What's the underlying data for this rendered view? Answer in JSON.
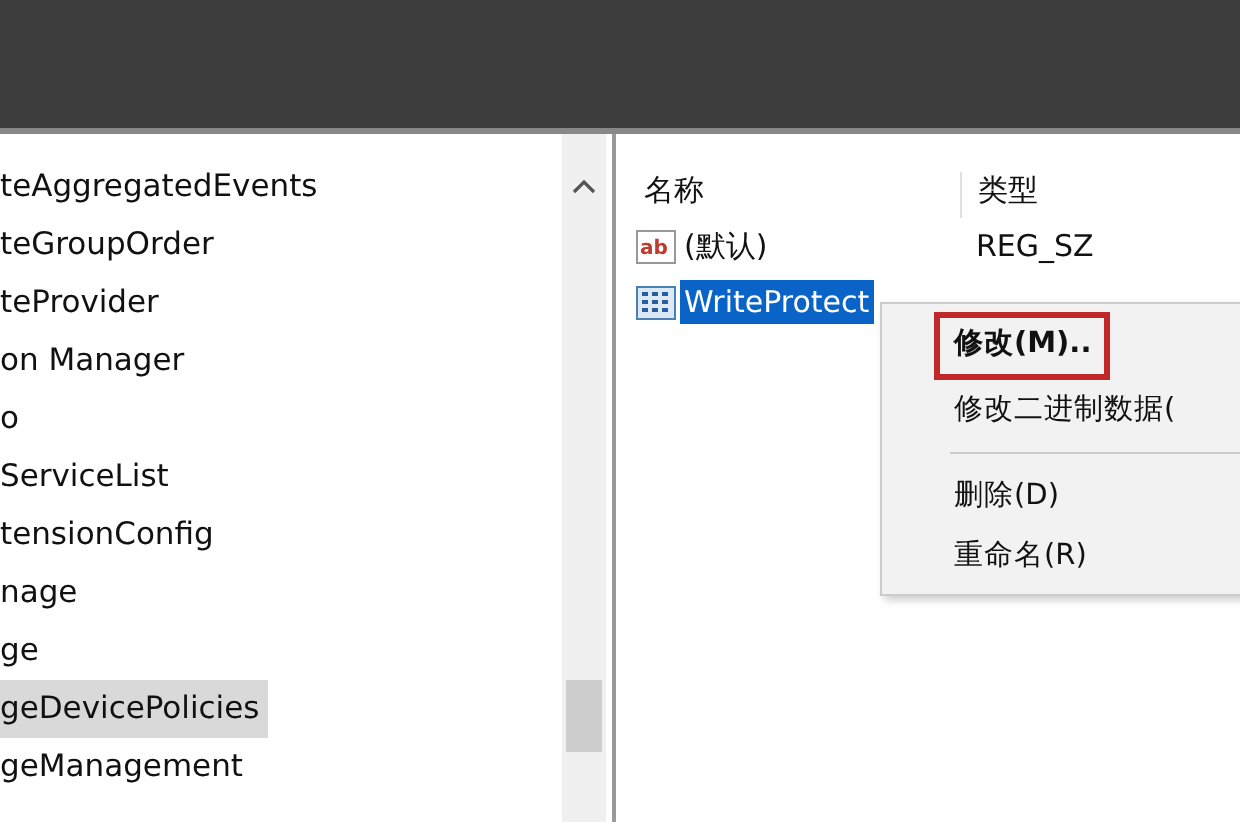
{
  "tree": {
    "items": [
      {
        "label": "teAggregatedEvents",
        "selected": false
      },
      {
        "label": "teGroupOrder",
        "selected": false
      },
      {
        "label": "teProvider",
        "selected": false
      },
      {
        "label": "on Manager",
        "selected": false
      },
      {
        "label": "o",
        "selected": false
      },
      {
        "label": "ServiceList",
        "selected": false
      },
      {
        "label": "tensionConfig",
        "selected": false
      },
      {
        "label": "nage",
        "selected": false
      },
      {
        "label": "ge",
        "selected": false
      },
      {
        "label": "geDevicePolicies",
        "selected": true
      },
      {
        "label": "geManagement",
        "selected": false
      }
    ]
  },
  "values": {
    "columns": [
      "名称",
      "类型"
    ],
    "rows": [
      {
        "kind": "string",
        "icon_label": "ab",
        "name": "(默认)",
        "type": "REG_SZ",
        "selected": false
      },
      {
        "kind": "binary",
        "name": "WriteProtect",
        "selected": true
      }
    ]
  },
  "context_menu": {
    "items": [
      {
        "kind": "item",
        "label": "修改(M)..",
        "bold": true,
        "highlighted": true
      },
      {
        "kind": "item",
        "label": "修改二进制数据(",
        "bold": false,
        "highlighted": false
      },
      {
        "kind": "separator"
      },
      {
        "kind": "item",
        "label": "删除(D)",
        "bold": false,
        "highlighted": false
      },
      {
        "kind": "item",
        "label": "重命名(R)",
        "bold": false,
        "highlighted": false
      }
    ]
  }
}
